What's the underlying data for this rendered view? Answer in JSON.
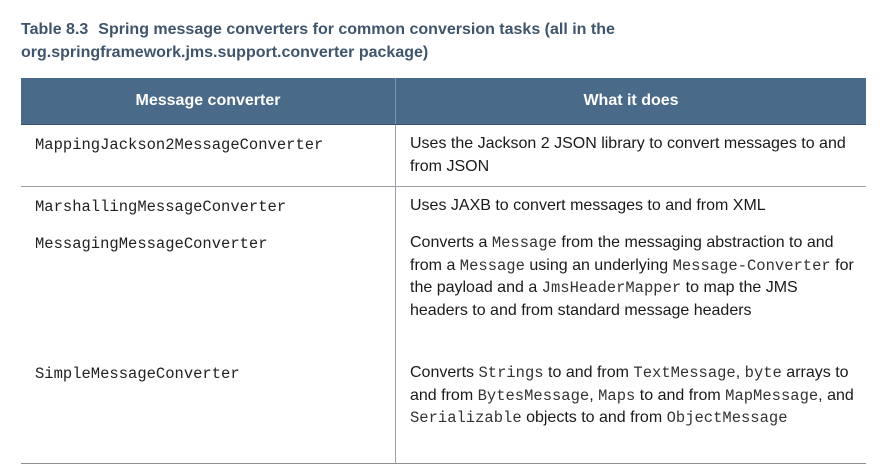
{
  "caption": {
    "number": "Table 8.3",
    "title": "Spring message converters for common conversion tasks (all in the org.springframework.jms.support.converter package)"
  },
  "table": {
    "headers": [
      "Message converter",
      "What it does"
    ],
    "rows": [
      {
        "converter": "MappingJackson2MessageConverter",
        "description": [
          {
            "t": "Uses the Jackson 2 JSON library to convert messages to and from JSON"
          }
        ]
      },
      {
        "converter": "MarshallingMessageConverter",
        "description": [
          {
            "t": "Uses JAXB to convert messages to and from XML"
          }
        ]
      },
      {
        "converter": "MessagingMessageConverter",
        "description": [
          {
            "t": "Converts a "
          },
          {
            "c": "Message"
          },
          {
            "t": " from the messaging abstraction to and from a "
          },
          {
            "c": "Message"
          },
          {
            "t": " using an underlying "
          },
          {
            "c": "Message-Converter"
          },
          {
            "t": " for the payload and a "
          },
          {
            "c": "JmsHeaderMapper"
          },
          {
            "t": " to map the JMS headers to and from standard message headers"
          }
        ]
      },
      {
        "converter": "SimpleMessageConverter",
        "description": [
          {
            "t": "Converts "
          },
          {
            "c": "Strings"
          },
          {
            "t": " to and from "
          },
          {
            "c": "TextMessage"
          },
          {
            "t": ", "
          },
          {
            "c": "byte"
          },
          {
            "t": " arrays to and from "
          },
          {
            "c": "BytesMessage"
          },
          {
            "t": ", "
          },
          {
            "c": "Maps"
          },
          {
            "t": " to and from "
          },
          {
            "c": "MapMessage"
          },
          {
            "t": ", and "
          },
          {
            "c": "Serializable"
          },
          {
            "t": " objects to and from "
          },
          {
            "c": "ObjectMessage"
          }
        ]
      }
    ]
  }
}
